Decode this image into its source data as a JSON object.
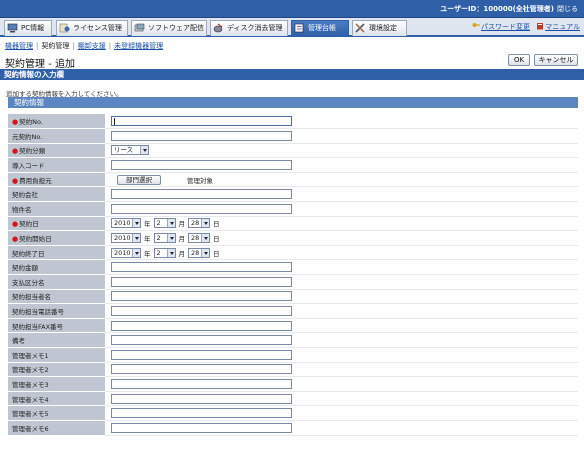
{
  "header": {
    "user_label": "ユーザーID：100000(全社管理者)",
    "logout": "閉じる"
  },
  "tabs": [
    {
      "label": "PC情報"
    },
    {
      "label": "ライセンス管理"
    },
    {
      "label": "ソフトウェア配信"
    },
    {
      "label": "ディスク消去管理"
    },
    {
      "label": "管理台帳"
    },
    {
      "label": "環境設定"
    }
  ],
  "right_links": {
    "password": "パスワード変更",
    "manual": "マニュアル"
  },
  "subnav": {
    "items": [
      "機器管理",
      "契約管理",
      "棚卸支援",
      "未登録機器管理"
    ]
  },
  "page": {
    "title": "契約管理 - 追加",
    "ok": "OK",
    "cancel": "キャンセル"
  },
  "section": {
    "title": "契約情報の入力欄",
    "note": "追加する契約情報を入力してください。",
    "subsection": "契約情報"
  },
  "form": {
    "required_mark": "●",
    "labels": {
      "contract_no": "契約No.",
      "original_no": "元契約No.",
      "contract_type": "契約分類",
      "purchase_code": "導入コード",
      "cost_bearer": "費用負担元",
      "contract_company": "契約会社",
      "item_name": "物件名",
      "contract_date": "契約日",
      "start_date": "契約開始日",
      "end_date": "契約終了日",
      "amount": "契約金額",
      "payment_type": "支払区分名",
      "person": "契約担当者名",
      "phone": "契約担当電話番号",
      "fax": "契約担当FAX番号",
      "remarks": "備考",
      "memo1": "管理者メモ1",
      "memo2": "管理者メモ2",
      "memo3": "管理者メモ3",
      "memo4": "管理者メモ4",
      "memo5": "管理者メモ5",
      "memo6": "管理者メモ6"
    },
    "contract_type_value": "リース",
    "dept_button": "部門選択",
    "dept_name": "管理対象",
    "date": {
      "year": "2010",
      "month": "2",
      "day": "28"
    },
    "units": {
      "year": "年",
      "month": "月",
      "day": "日"
    }
  }
}
